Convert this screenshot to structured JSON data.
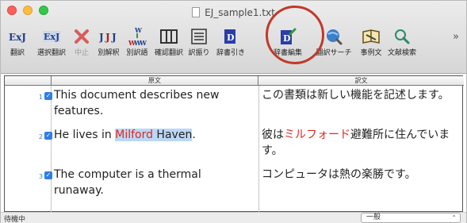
{
  "window": {
    "title": "EJ_sample1.txt"
  },
  "toolbar": {
    "items": [
      {
        "label": "翻訳",
        "icon": "translate-icon"
      },
      {
        "label": "選択翻訳",
        "icon": "selection-translate-icon"
      },
      {
        "label": "中止",
        "icon": "stop-icon"
      },
      {
        "label": "別解釈",
        "icon": "alternate-interpretation-icon"
      },
      {
        "label": "別訳語",
        "icon": "alternate-word-icon"
      },
      {
        "label": "確認翻訳",
        "icon": "confirm-translate-icon"
      },
      {
        "label": "訳振り",
        "icon": "interlinear-icon"
      },
      {
        "label": "辞書引き",
        "icon": "dictionary-lookup-icon"
      },
      {
        "label": "辞書編集",
        "icon": "dictionary-edit-icon"
      },
      {
        "label": "翻訳サーチ",
        "icon": "translation-search-icon"
      },
      {
        "label": "事例文",
        "icon": "example-sentence-icon"
      },
      {
        "label": "文献検索",
        "icon": "literature-search-icon"
      }
    ],
    "overflow": "»"
  },
  "table": {
    "header_source": "原文",
    "header_target": "訳文",
    "rows": [
      {
        "num": "1",
        "source": "This document describes new features.",
        "target": "この書類は新しい機能を記述します。"
      },
      {
        "num": "2",
        "source_pre": "He lives in ",
        "source_red": "Milford",
        "source_sel": " Haven",
        "source_post": ".",
        "target_pre": "彼は",
        "target_red": "ミルフォード",
        "target_post": "避難所に住んでいます。"
      },
      {
        "num": "3",
        "source": "The computer is a thermal runaway.",
        "target": "コンピュータは熱の楽勝です。"
      }
    ]
  },
  "status": {
    "text": "待機中",
    "dropdown_value": "一般"
  },
  "colors": {
    "accent": "#2f7ee8",
    "highlight": "#e0281e",
    "annotation": "#c0392b"
  }
}
